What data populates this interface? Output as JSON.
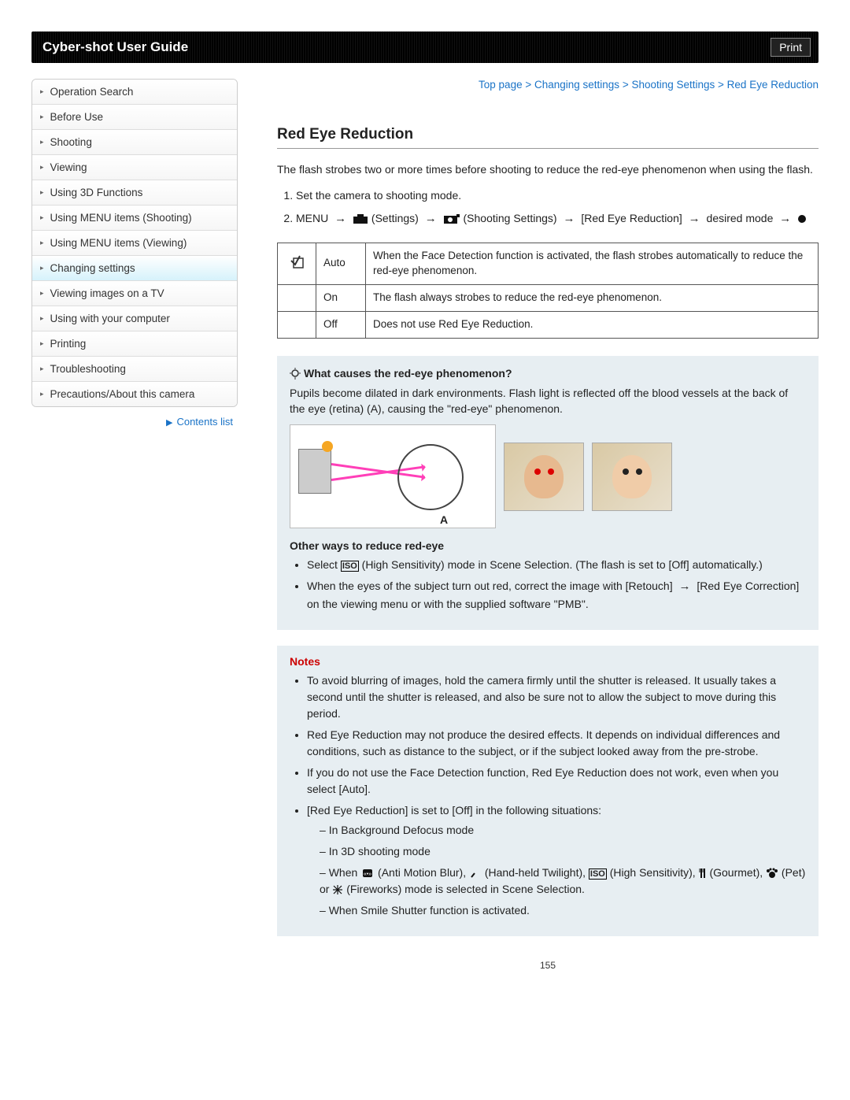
{
  "header": {
    "title": "Cyber-shot User Guide",
    "print": "Print"
  },
  "nav": {
    "items": [
      "Operation Search",
      "Before Use",
      "Shooting",
      "Viewing",
      "Using 3D Functions",
      "Using MENU items (Shooting)",
      "Using MENU items (Viewing)",
      "Changing settings",
      "Viewing images on a TV",
      "Using with your computer",
      "Printing",
      "Troubleshooting",
      "Precautions/About this camera"
    ],
    "active_index": 7,
    "contents_link": "Contents list"
  },
  "breadcrumb": {
    "parts": [
      "Top page",
      "Changing settings",
      "Shooting Settings",
      "Red Eye Reduction"
    ],
    "sep": " > "
  },
  "page_title": "Red Eye Reduction",
  "intro": "The flash strobes two or more times before shooting to reduce the red-eye phenomenon when using the flash.",
  "steps": [
    "Set the camera to shooting mode.",
    {
      "prefix": "MENU",
      "seq_settings": "(Settings)",
      "seq_shooting": "(Shooting Settings)",
      "seq_item": "[Red Eye Reduction]",
      "seq_mode": "desired mode"
    }
  ],
  "options": [
    {
      "icon": "check",
      "name": "Auto",
      "desc": "When the Face Detection function is activated, the flash strobes automatically to reduce the red-eye phenomenon."
    },
    {
      "icon": "",
      "name": "On",
      "desc": "The flash always strobes to reduce the red-eye phenomenon."
    },
    {
      "icon": "",
      "name": "Off",
      "desc": "Does not use Red Eye Reduction."
    }
  ],
  "info": {
    "heading": "What causes the red-eye phenomenon?",
    "body": "Pupils become dilated in dark environments. Flash light is reflected off the blood vessels at the back of the eye (retina) (A), causing the \"red-eye\" phenomenon.",
    "diagram_label": "A",
    "other_heading": "Other ways to reduce red-eye",
    "other_items": [
      "Select  (High Sensitivity) mode in Scene Selection. (The flash is set to [Off] automatically.)",
      "When the eyes of the subject turn out red, correct the image with [Retouch] → [Red Eye Correction] on the viewing menu or with the supplied software \"PMB\"."
    ],
    "iso_label": "ISO"
  },
  "notes": {
    "title": "Notes",
    "items": [
      "To avoid blurring of images, hold the camera firmly until the shutter is released. It usually takes a second until the shutter is released, and also be sure not to allow the subject to move during this period.",
      "Red Eye Reduction may not produce the desired effects. It depends on individual differences and conditions, such as distance to the subject, or if the subject looked away from the pre-strobe.",
      "If you do not use the Face Detection function, Red Eye Reduction does not work, even when you select [Auto].",
      "[Red Eye Reduction] is set to [Off] in the following situations:"
    ],
    "sub_items": [
      "In Background Defocus mode",
      "In 3D shooting mode",
      "When  (Anti Motion Blur),  (Hand-held Twilight),  (High Sensitivity),  (Gourmet),  (Pet) or  (Fireworks) mode is selected in Scene Selection.",
      "When Smile Shutter function is activated."
    ],
    "mode_labels": {
      "anti_motion": "(Anti Motion Blur)",
      "twilight": "(Hand-held Twilight)",
      "high_sens": "(High Sensitivity)",
      "gourmet": "(Gourmet)",
      "pet": "(Pet)",
      "fireworks": "(Fireworks)",
      "tail": " mode is selected in Scene Selection."
    }
  },
  "page_number": "155"
}
